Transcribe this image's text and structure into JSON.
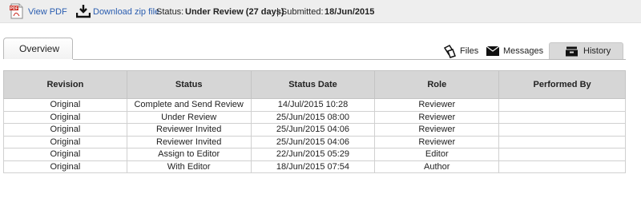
{
  "toolbar": {
    "view_pdf_label": "View PDF",
    "download_zip_label": "Download zip file",
    "status_label": "Status:",
    "status_value": "Under Review (27 days)",
    "submitted_separator": "| Submitted:",
    "submitted_value": "18/Jun/2015",
    "link_color": "#2a5db0"
  },
  "tabs": {
    "overview": "Overview",
    "files": "Files",
    "messages": "Messages",
    "history": "History",
    "active": "History"
  },
  "icons": {
    "pdf": "pdf-file-icon",
    "zip": "download-icon",
    "files": "files-icon",
    "messages": "envelope-icon",
    "history": "inbox-tray-icon"
  },
  "table": {
    "headers": [
      "Revision",
      "Status",
      "Status Date",
      "Role",
      "Performed By"
    ],
    "rows": [
      [
        "Original",
        "Complete and Send Review",
        "14/Jul/2015 10:28",
        "Reviewer",
        ""
      ],
      [
        "Original",
        "Under Review",
        "25/Jun/2015 08:00",
        "Reviewer",
        ""
      ],
      [
        "Original",
        "Reviewer Invited",
        "25/Jun/2015 04:06",
        "Reviewer",
        ""
      ],
      [
        "Original",
        "Reviewer Invited",
        "25/Jun/2015 04:06",
        "Reviewer",
        ""
      ],
      [
        "Original",
        "Assign to Editor",
        "22/Jun/2015 05:29",
        "Editor",
        ""
      ],
      [
        "Original",
        "With Editor",
        "18/Jun/2015 07:54",
        "Author",
        ""
      ]
    ]
  }
}
